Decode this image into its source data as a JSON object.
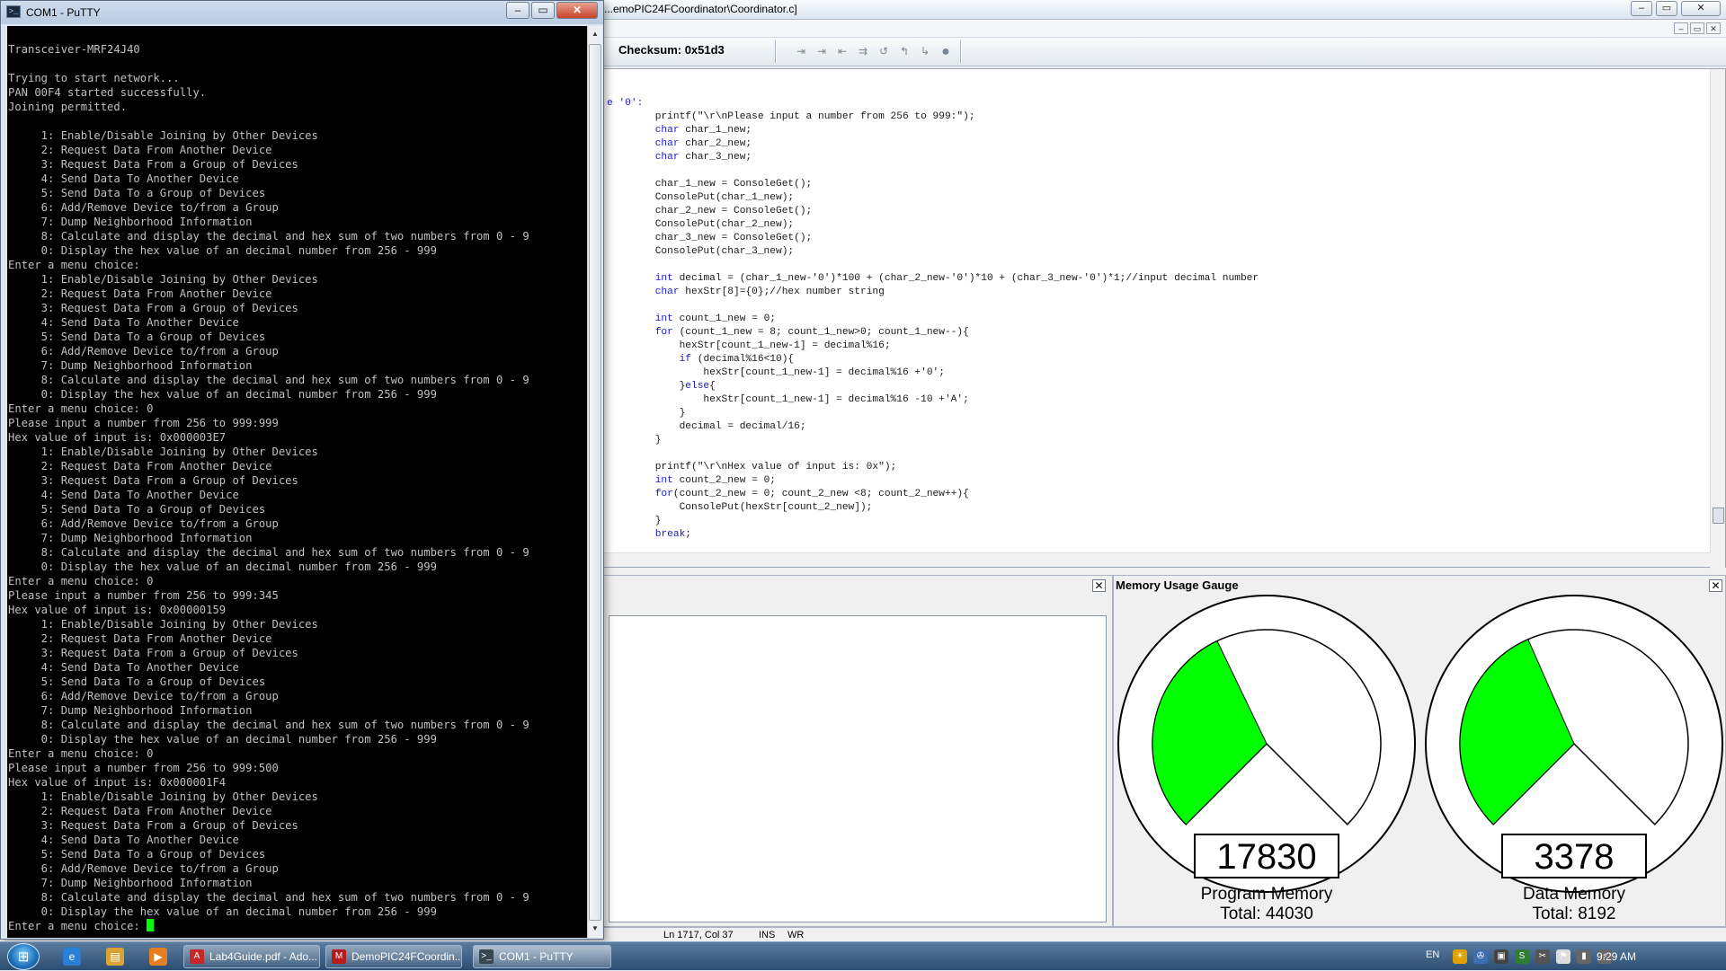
{
  "ide": {
    "title": "...emoPIC24FCoordinator\\Coordinator.c]",
    "title_buttons": {
      "minimize": "–",
      "restore": "▭",
      "close": "✕"
    },
    "mdi_buttons": {
      "minimize": "–",
      "restore": "▭",
      "close": "✕"
    },
    "checksum_label": "Checksum:  0x51d3",
    "editor_lines": [
      [
        {
          "t": "e '0':",
          "c": "kw"
        }
      ],
      [
        {
          "t": "        printf(\"\\r\\nPlease input a number from 256 to 999:\");"
        }
      ],
      [
        {
          "t": "        "
        },
        {
          "t": "char",
          "c": "kw"
        },
        {
          "t": " char_1_new;"
        }
      ],
      [
        {
          "t": "        "
        },
        {
          "t": "char",
          "c": "kw"
        },
        {
          "t": " char_2_new;"
        }
      ],
      [
        {
          "t": "        "
        },
        {
          "t": "char",
          "c": "kw"
        },
        {
          "t": " char_3_new;"
        }
      ],
      [
        {
          "t": ""
        }
      ],
      [
        {
          "t": "        char_1_new = ConsoleGet();"
        }
      ],
      [
        {
          "t": "        ConsolePut(char_1_new);"
        }
      ],
      [
        {
          "t": "        char_2_new = ConsoleGet();"
        }
      ],
      [
        {
          "t": "        ConsolePut(char_2_new);"
        }
      ],
      [
        {
          "t": "        char_3_new = ConsoleGet();"
        }
      ],
      [
        {
          "t": "        ConsolePut(char_3_new);"
        }
      ],
      [
        {
          "t": ""
        }
      ],
      [
        {
          "t": "        "
        },
        {
          "t": "int",
          "c": "kw"
        },
        {
          "t": " decimal = (char_1_new-'0')*100 + (char_2_new-'0')*10 + (char_3_new-'0')*1;//input decimal number"
        }
      ],
      [
        {
          "t": "        "
        },
        {
          "t": "char",
          "c": "kw"
        },
        {
          "t": " hexStr[8]={0};//hex number string"
        }
      ],
      [
        {
          "t": ""
        }
      ],
      [
        {
          "t": "        "
        },
        {
          "t": "int",
          "c": "kw"
        },
        {
          "t": " count_1_new = 0;"
        }
      ],
      [
        {
          "t": "        "
        },
        {
          "t": "for",
          "c": "kw"
        },
        {
          "t": " (count_1_new = 8; count_1_new>0; count_1_new--){"
        }
      ],
      [
        {
          "t": "            hexStr[count_1_new-1] = decimal%16;"
        }
      ],
      [
        {
          "t": "            "
        },
        {
          "t": "if",
          "c": "kw"
        },
        {
          "t": " (decimal%16<10){"
        }
      ],
      [
        {
          "t": "                hexStr[count_1_new-1] = decimal%16 +'0';"
        }
      ],
      [
        {
          "t": "            }"
        },
        {
          "t": "else",
          "c": "kw"
        },
        {
          "t": "{"
        }
      ],
      [
        {
          "t": "                hexStr[count_1_new-1] = decimal%16 -10 +'A';"
        }
      ],
      [
        {
          "t": "            }"
        }
      ],
      [
        {
          "t": "            decimal = decimal/16;"
        }
      ],
      [
        {
          "t": "        }"
        }
      ],
      [
        {
          "t": ""
        }
      ],
      [
        {
          "t": "        printf(\"\\r\\nHex value of input is: 0x\");"
        }
      ],
      [
        {
          "t": "        "
        },
        {
          "t": "int",
          "c": "kw"
        },
        {
          "t": " count_2_new = 0;"
        }
      ],
      [
        {
          "t": "        "
        },
        {
          "t": "for",
          "c": "kw"
        },
        {
          "t": "(count_2_new = 0; count_2_new <8; count_2_new++){"
        }
      ],
      [
        {
          "t": "            ConsolePut(hexStr[count_2_new]);"
        }
      ],
      [
        {
          "t": "        }"
        }
      ],
      [
        {
          "t": "        "
        },
        {
          "t": "break",
          "c": "kw"
        },
        {
          "t": ";"
        }
      ]
    ],
    "pane_close": "✕",
    "gauge_pane_title": "Memory Usage Gauge",
    "gauges": [
      {
        "name": "program",
        "value": "17830",
        "caption": "Program Memory",
        "total": "Total: 44030",
        "used_fraction": 0.405
      },
      {
        "name": "data",
        "value": "3378",
        "caption": "Data Memory",
        "total": "Total: 8192",
        "used_fraction": 0.412
      }
    ],
    "status": {
      "position": "Ln 1717, Col 37",
      "ins": "INS",
      "wr": "WR"
    },
    "colors": {
      "gauge_fill": "#00ff00",
      "keyword": "#1b1bd0"
    }
  },
  "putty": {
    "title": "COM1 - PuTTY",
    "icon": ">_",
    "title_buttons": {
      "minimize": "–",
      "maximize": "▭",
      "close": "✕"
    },
    "terminal_text": "Transceiver-MRF24J40\n\nTrying to start network...\nPAN 00F4 started successfully.\nJoining permitted.\n\n     1: Enable/Disable Joining by Other Devices\n     2: Request Data From Another Device\n     3: Request Data From a Group of Devices\n     4: Send Data To Another Device\n     5: Send Data To a Group of Devices\n     6: Add/Remove Device to/from a Group\n     7: Dump Neighborhood Information\n     8: Calculate and display the decimal and hex sum of two numbers from 0 - 9\n     0: Display the hex value of an decimal number from 256 - 999\nEnter a menu choice:\n     1: Enable/Disable Joining by Other Devices\n     2: Request Data From Another Device\n     3: Request Data From a Group of Devices\n     4: Send Data To Another Device\n     5: Send Data To a Group of Devices\n     6: Add/Remove Device to/from a Group\n     7: Dump Neighborhood Information\n     8: Calculate and display the decimal and hex sum of two numbers from 0 - 9\n     0: Display the hex value of an decimal number from 256 - 999\nEnter a menu choice: 0\nPlease input a number from 256 to 999:999\nHex value of input is: 0x000003E7\n     1: Enable/Disable Joining by Other Devices\n     2: Request Data From Another Device\n     3: Request Data From a Group of Devices\n     4: Send Data To Another Device\n     5: Send Data To a Group of Devices\n     6: Add/Remove Device to/from a Group\n     7: Dump Neighborhood Information\n     8: Calculate and display the decimal and hex sum of two numbers from 0 - 9\n     0: Display the hex value of an decimal number from 256 - 999\nEnter a menu choice: 0\nPlease input a number from 256 to 999:345\nHex value of input is: 0x00000159\n     1: Enable/Disable Joining by Other Devices\n     2: Request Data From Another Device\n     3: Request Data From a Group of Devices\n     4: Send Data To Another Device\n     5: Send Data To a Group of Devices\n     6: Add/Remove Device to/from a Group\n     7: Dump Neighborhood Information\n     8: Calculate and display the decimal and hex sum of two numbers from 0 - 9\n     0: Display the hex value of an decimal number from 256 - 999\nEnter a menu choice: 0\nPlease input a number from 256 to 999:500\nHex value of input is: 0x000001F4\n     1: Enable/Disable Joining by Other Devices\n     2: Request Data From Another Device\n     3: Request Data From a Group of Devices\n     4: Send Data To Another Device\n     5: Send Data To a Group of Devices\n     6: Add/Remove Device to/from a Group\n     7: Dump Neighborhood Information\n     8: Calculate and display the decimal and hex sum of two numbers from 0 - 9\n     0: Display the hex value of an decimal number from 256 - 999\nEnter a menu choice: ",
    "cursor_color": "#00ff00"
  },
  "taskbar": {
    "start": "⊞",
    "quick_launch": [
      {
        "name": "ie-icon",
        "glyph": "e",
        "color": "#2b7fd6"
      },
      {
        "name": "explorer-icon",
        "glyph": "▤",
        "color": "#d9a430"
      },
      {
        "name": "media-player-icon",
        "glyph": "▶",
        "color": "#e67e22"
      }
    ],
    "tasks": [
      {
        "name": "task-lab4guide",
        "label": "Lab4Guide.pdf - Ado...",
        "icon_glyph": "A",
        "icon_color": "#c62828"
      },
      {
        "name": "task-mplab",
        "label": "DemoPIC24FCoordin...",
        "icon_glyph": "M",
        "icon_color": "#b71c1c"
      },
      {
        "name": "task-putty",
        "label": "COM1 - PuTTY",
        "icon_glyph": ">_",
        "icon_color": "#37474f"
      }
    ],
    "language": "EN",
    "tray_icons": [
      {
        "name": "tray-icon-1",
        "glyph": "☀",
        "color": "#e0a000"
      },
      {
        "name": "tray-icon-2",
        "glyph": "✇",
        "color": "#3a6fb0"
      },
      {
        "name": "tray-icon-3",
        "glyph": "▣",
        "color": "#444"
      },
      {
        "name": "tray-icon-4",
        "glyph": "S",
        "color": "#2e7d32"
      },
      {
        "name": "tray-icon-5",
        "glyph": "✂",
        "color": "#555"
      },
      {
        "name": "tray-icon-6",
        "glyph": "⚑",
        "color": "#ddd"
      },
      {
        "name": "tray-network-icon",
        "glyph": "▮",
        "color": "#666"
      },
      {
        "name": "tray-volume-icon",
        "glyph": "♪",
        "color": "#666"
      }
    ],
    "clock": "9:29 AM"
  }
}
